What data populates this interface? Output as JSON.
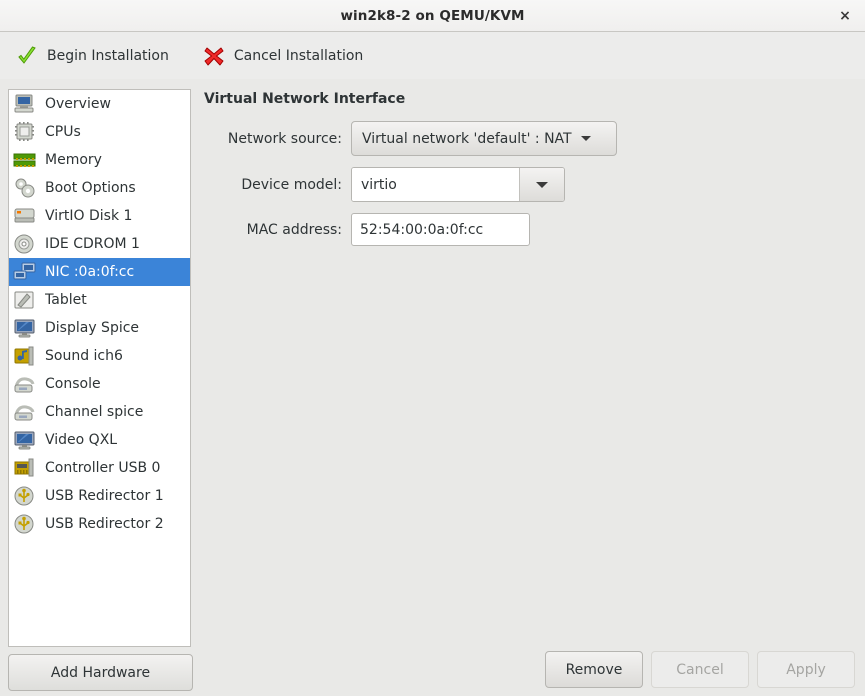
{
  "window": {
    "title": "win2k8-2 on QEMU/KVM",
    "close_label": "×"
  },
  "toolbar": {
    "begin_label": "Begin Installation",
    "begin_icon": "green-check-icon",
    "cancel_label": "Cancel Installation",
    "cancel_icon": "red-x-icon"
  },
  "sidebar": {
    "items": [
      {
        "label": "Overview",
        "icon": "computer-icon",
        "selected": false
      },
      {
        "label": "CPUs",
        "icon": "cpu-chip-icon",
        "selected": false
      },
      {
        "label": "Memory",
        "icon": "memory-ram-icon",
        "selected": false
      },
      {
        "label": "Boot Options",
        "icon": "gears-icon",
        "selected": false
      },
      {
        "label": "VirtIO Disk 1",
        "icon": "harddisk-icon",
        "selected": false
      },
      {
        "label": "IDE CDROM 1",
        "icon": "cdrom-icon",
        "selected": false
      },
      {
        "label": "NIC :0a:0f:cc",
        "icon": "network-card-icon",
        "selected": true
      },
      {
        "label": "Tablet",
        "icon": "tablet-pen-icon",
        "selected": false
      },
      {
        "label": "Display Spice",
        "icon": "display-monitor-icon",
        "selected": false
      },
      {
        "label": "Sound ich6",
        "icon": "sound-card-icon",
        "selected": false
      },
      {
        "label": "Console",
        "icon": "serial-console-icon",
        "selected": false
      },
      {
        "label": "Channel spice",
        "icon": "serial-console-icon",
        "selected": false
      },
      {
        "label": "Video QXL",
        "icon": "display-monitor-icon",
        "selected": false
      },
      {
        "label": "Controller USB 0",
        "icon": "controller-card-icon",
        "selected": false
      },
      {
        "label": "USB Redirector 1",
        "icon": "usb-icon",
        "selected": false
      },
      {
        "label": "USB Redirector 2",
        "icon": "usb-icon",
        "selected": false
      }
    ],
    "add_hardware_label": "Add Hardware"
  },
  "pane": {
    "title": "Virtual Network Interface",
    "fields": {
      "network_source_label": "Network source:",
      "network_source_value": "Virtual network 'default' : NAT",
      "device_model_label": "Device model:",
      "device_model_value": "virtio",
      "mac_address_label": "MAC address:",
      "mac_address_value": "52:54:00:0a:0f:cc"
    }
  },
  "buttons": {
    "remove_label": "Remove",
    "cancel_label": "Cancel",
    "apply_label": "Apply"
  },
  "colors": {
    "selection_blue": "#3b84d8",
    "background": "#e9e9e7",
    "check_green": "#73d216",
    "x_red": "#cc0000"
  }
}
